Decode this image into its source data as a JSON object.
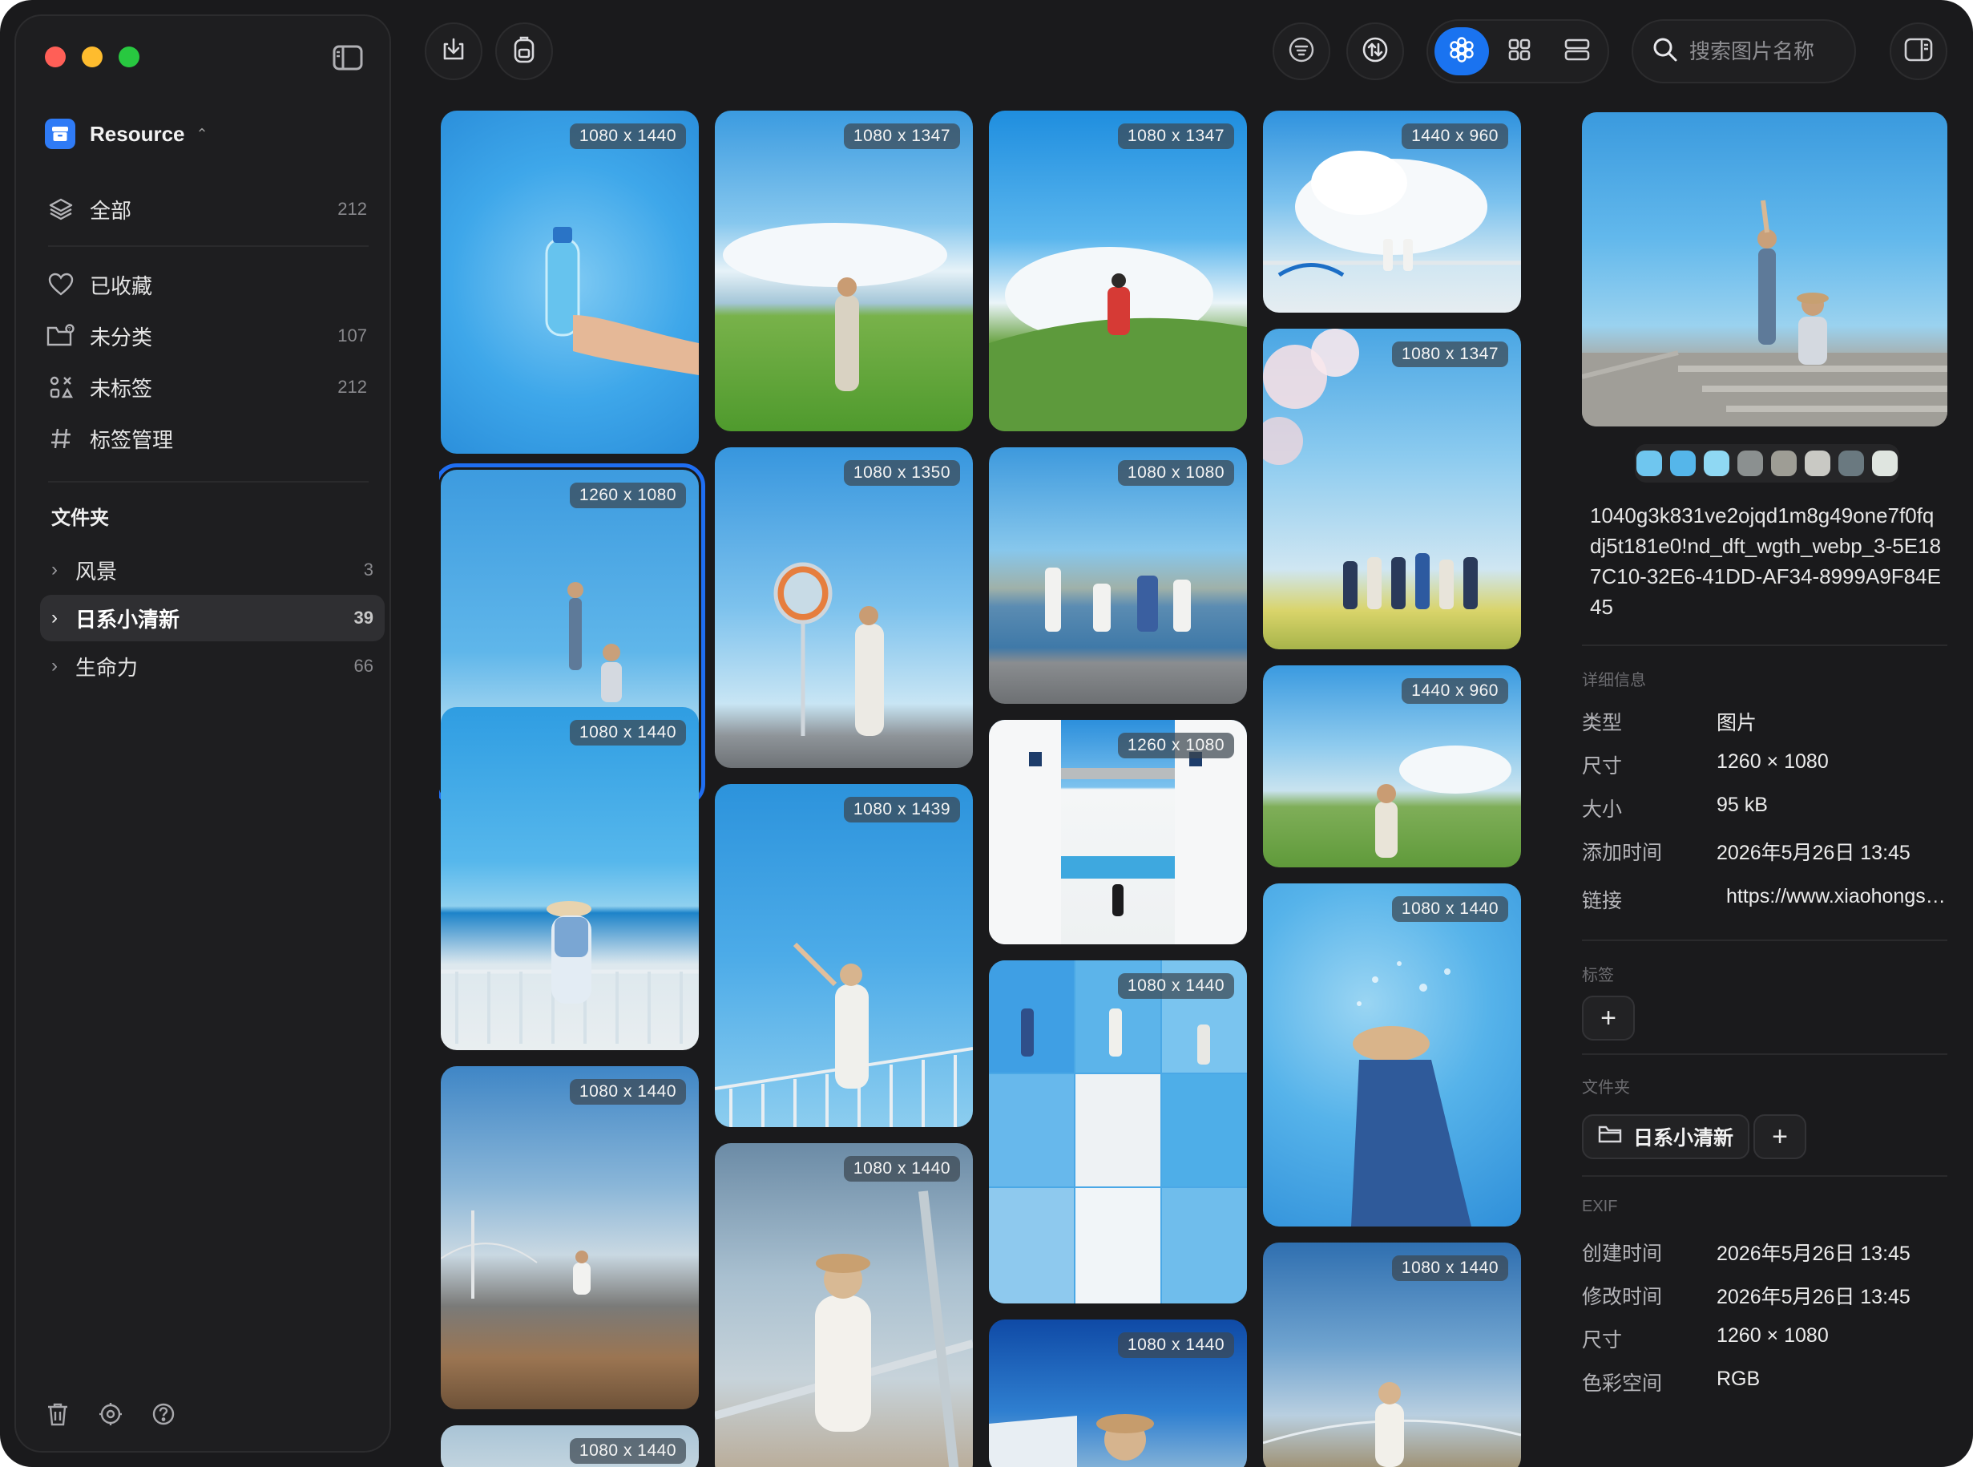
{
  "sidebar": {
    "library": {
      "name": "Resource"
    },
    "nav": [
      {
        "label": "全部",
        "count": "212",
        "icon": "layers-icon"
      },
      {
        "label": "已收藏",
        "count": "",
        "icon": "heart-icon"
      },
      {
        "label": "未分类",
        "count": "107",
        "icon": "folder-question-icon"
      },
      {
        "label": "未标签",
        "count": "212",
        "icon": "tag-off-icon"
      },
      {
        "label": "标签管理",
        "count": "",
        "icon": "hash-icon"
      }
    ],
    "folders_title": "文件夹",
    "folders": [
      {
        "label": "风景",
        "count": "3"
      },
      {
        "label": "日系小清新",
        "count": "39",
        "active": true
      },
      {
        "label": "生命力",
        "count": "66"
      }
    ]
  },
  "toolbar": {
    "search_placeholder": "搜索图片名称"
  },
  "gallery": {
    "items": [
      {
        "dims": "1080 x 1440",
        "tone": "bottle"
      },
      {
        "dims": "1260 x 1080",
        "tone": "stairs",
        "selected": true
      },
      {
        "dims": "1080 x 1440",
        "tone": "railing"
      },
      {
        "dims": "1080 x 1440",
        "tone": "beach"
      },
      {
        "dims": "1080 x 1440",
        "tone": "sky"
      },
      {
        "dims": "1080 x 1347",
        "tone": "field"
      },
      {
        "dims": "1080 x 1350",
        "tone": "mirror"
      },
      {
        "dims": "1080 x 1439",
        "tone": "sky"
      },
      {
        "dims": "1080 x 1440",
        "tone": "portrait"
      },
      {
        "dims": "1080 x 1347",
        "tone": "hill"
      },
      {
        "dims": "1080 x 1080",
        "tone": "sea"
      },
      {
        "dims": "1260 x 1080",
        "tone": "white"
      },
      {
        "dims": "1080 x 1440",
        "tone": "collage"
      },
      {
        "dims": "1080 x 1440",
        "tone": "deep"
      },
      {
        "dims": "1440 x 960",
        "tone": "cloud"
      },
      {
        "dims": "1080 x 1347",
        "tone": "blossom"
      },
      {
        "dims": "1440 x 960",
        "tone": "field"
      },
      {
        "dims": "1080 x 1440",
        "tone": "splash"
      },
      {
        "dims": "1080 x 1440",
        "tone": "bridge"
      }
    ]
  },
  "inspector": {
    "palette": [
      "#6fc6ef",
      "#55b6ea",
      "#8fd8f3",
      "#8b9090",
      "#9e9d95",
      "#c9c9c4",
      "#6a7980",
      "#dfe5e0"
    ],
    "filename": "1040g3k831ve2ojqd1m8g49one7f0fqdj5t181e0!nd_dft_wgth_webp_3-5E187C10-32E6-41DD-AF34-8999A9F84E45",
    "details_title": "详细信息",
    "details": [
      {
        "k": "类型",
        "v": "图片"
      },
      {
        "k": "尺寸",
        "v": "1260 × 1080"
      },
      {
        "k": "大小",
        "v": "95 kB"
      },
      {
        "k": "添加时间",
        "v": "2026年5月26日 13:45"
      },
      {
        "k": "链接",
        "v": "https://www.xiaohongshu.com"
      }
    ],
    "tags_title": "标签",
    "add_label": "+",
    "folder_title": "文件夹",
    "folder_chip": "日系小清新",
    "exif_title": "EXIF",
    "exif": [
      {
        "k": "创建时间",
        "v": "2026年5月26日 13:45"
      },
      {
        "k": "修改时间",
        "v": "2026年5月26日 13:45"
      },
      {
        "k": "尺寸",
        "v": "1260 × 1080"
      },
      {
        "k": "色彩空间",
        "v": "RGB"
      }
    ]
  }
}
